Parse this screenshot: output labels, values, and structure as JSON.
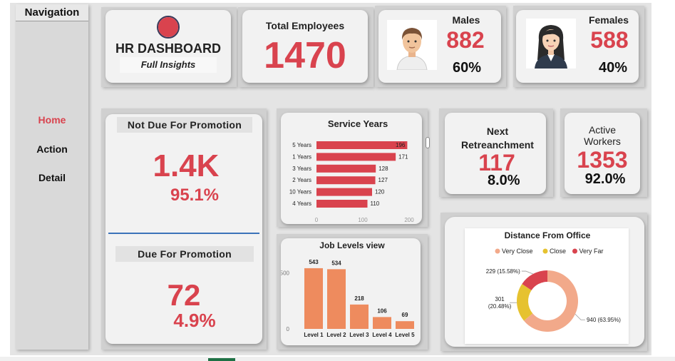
{
  "navigation": {
    "title": "Navigation",
    "items": [
      {
        "label": "Home",
        "active": true
      },
      {
        "label": "Action",
        "active": false
      },
      {
        "label": "Detail",
        "active": false
      }
    ]
  },
  "header": {
    "title": "HR DASHBOARD",
    "subtitle": "Full Insights",
    "logo_color": "#d9434e"
  },
  "kpis": {
    "total_employees": {
      "label": "Total Employees",
      "value": "1470"
    },
    "males": {
      "label": "Males",
      "value": "882",
      "percent": "60%",
      "icon": "man-avatar-icon"
    },
    "females": {
      "label": "Females",
      "value": "588",
      "percent": "40%",
      "icon": "woman-avatar-icon"
    },
    "not_due_promotion": {
      "label": "Not Due For Promotion",
      "value": "1.4K",
      "percent": "95.1%"
    },
    "due_promotion": {
      "label": "Due For Promotion",
      "value": "72",
      "percent": "4.9%"
    },
    "next_retrenchment": {
      "label_line1": "Next",
      "label_line2": "Retreanchment",
      "value": "117",
      "percent": "8.0%"
    },
    "active_workers": {
      "label_line1": "Active",
      "label_line2": "Workers",
      "value": "1353",
      "percent": "92.0%"
    }
  },
  "colors": {
    "accent_red": "#d9434e",
    "bar_orange": "#ee8b5e",
    "donut_salmon": "#f2a98a",
    "donut_yellow": "#e6c22f",
    "donut_red": "#d9434e",
    "divider_blue": "#3b73b9"
  },
  "chart_data": [
    {
      "type": "bar",
      "orientation": "horizontal",
      "title": "Service Years",
      "categories": [
        "5 Years",
        "1 Years",
        "3 Years",
        "2 Years",
        "10 Years",
        "4 Years"
      ],
      "values": [
        196,
        171,
        128,
        127,
        120,
        110
      ],
      "xlim": [
        0,
        200
      ],
      "xticks": [
        "0",
        "100",
        "200"
      ]
    },
    {
      "type": "bar",
      "orientation": "vertical",
      "title": "Job Levels view",
      "categories": [
        "Level 1",
        "Level 2",
        "Level 3",
        "Level 4",
        "Level 5"
      ],
      "values": [
        543,
        534,
        218,
        106,
        69
      ],
      "ylim": [
        0,
        600
      ],
      "yticks": [
        "0",
        "500"
      ]
    },
    {
      "type": "pie",
      "style": "donut",
      "title": "Distance From Office",
      "legend_placement": "top",
      "series": [
        {
          "name": "Very Close",
          "value": 940,
          "label": "940 (63.95%)"
        },
        {
          "name": "Close",
          "value": 301,
          "label_line1": "301",
          "label_line2": "(20.48%)"
        },
        {
          "name": "Very Far",
          "value": 229,
          "label": "229 (15.58%)"
        }
      ]
    }
  ]
}
